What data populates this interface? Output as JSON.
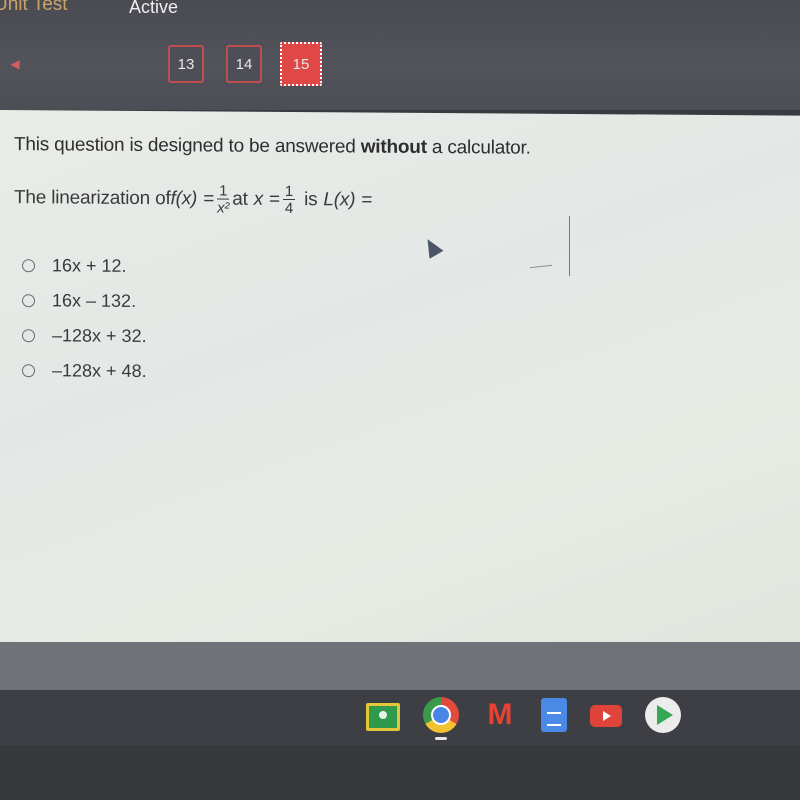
{
  "header": {
    "title": "Unit Test",
    "status": "Active",
    "prev_icon": "caret-left-icon",
    "question_nav": [
      {
        "label": "13",
        "current": false
      },
      {
        "label": "14",
        "current": false
      },
      {
        "label": "15",
        "current": true
      }
    ]
  },
  "question": {
    "instruction_pre": "This question is designed to be answered ",
    "instruction_bold": "without",
    "instruction_post": " a calculator.",
    "stem_pre": "The linearization of ",
    "fn_name": "f(x)",
    "equals": "=",
    "fn_num": "1",
    "fn_den": "x²",
    "at_text": "at",
    "var": "x",
    "point_num": "1",
    "point_den": "4",
    "is_text": "is",
    "result_name": "L(x)",
    "result_equals": "="
  },
  "options": [
    {
      "label": "16x + 12.",
      "selected": false
    },
    {
      "label": "16x – 132.",
      "selected": false
    },
    {
      "label": "–128x + 32.",
      "selected": false
    },
    {
      "label": "–128x + 48.",
      "selected": false
    }
  ],
  "shelf": {
    "apps": [
      {
        "name": "Google Classroom",
        "icon": "classroom-icon"
      },
      {
        "name": "Google Chrome",
        "icon": "chrome-icon",
        "running": true
      },
      {
        "name": "Gmail",
        "icon": "gmail-icon"
      },
      {
        "name": "Google Docs",
        "icon": "docs-icon"
      },
      {
        "name": "YouTube",
        "icon": "youtube-icon"
      },
      {
        "name": "Google Play Store",
        "icon": "play-store-icon"
      }
    ],
    "gmail_glyph": "M"
  }
}
